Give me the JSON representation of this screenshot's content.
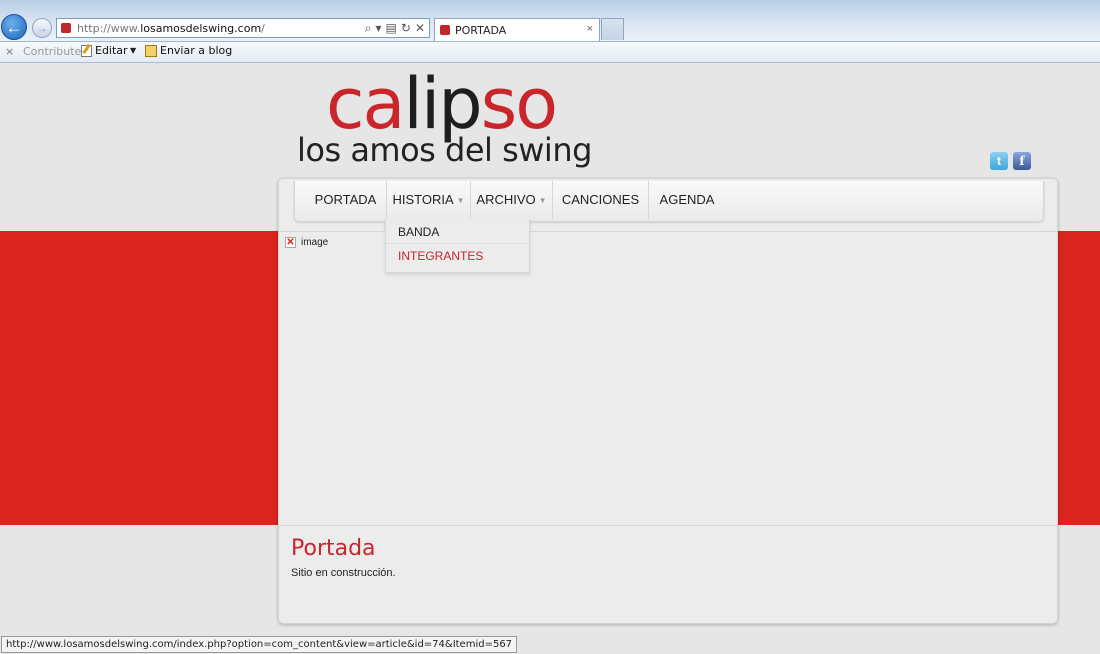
{
  "browser": {
    "address_prefix": "http://www.",
    "address_domain": "losamosdelswing.com",
    "address_suffix": "/",
    "tab_title": "PORTADA",
    "tab_close": "×",
    "back_glyph": "←",
    "forward_glyph": "→",
    "address_icons": [
      "⌕",
      "▾",
      "▤",
      "↻",
      "✕"
    ]
  },
  "command_bar": {
    "close": "×",
    "contribute": "Contribute",
    "edit": "Editar",
    "edit_dropdown": "▼",
    "send_to_blog": "Enviar a blog"
  },
  "logo": {
    "part1": "ca",
    "part2": "lip",
    "part3": "so",
    "subtitle": "los amos del swing"
  },
  "social": {
    "twitter_glyph": "t",
    "facebook_glyph": "f"
  },
  "nav": {
    "items": [
      {
        "label": "PORTADA",
        "has_submenu": false
      },
      {
        "label": "HISTORIA",
        "has_submenu": true
      },
      {
        "label": "ARCHIVO",
        "has_submenu": true
      },
      {
        "label": "CANCIONES",
        "has_submenu": false
      },
      {
        "label": "AGENDA",
        "has_submenu": false
      }
    ],
    "submenu_arrow": "▼"
  },
  "dropdown": {
    "items": [
      "BANDA",
      "INTEGRANTES"
    ]
  },
  "banner": {
    "broken_alt": "image",
    "broken_glyph": "✕"
  },
  "article": {
    "title": "Portada",
    "body": "Sitio en construcción."
  },
  "status_bar": {
    "url": "http://www.losamosdelswing.com/index.php?option=com_content&view=article&id=74&Itemid=567"
  },
  "colors": {
    "brand_red": "#c9252b",
    "band_red": "#d9251d",
    "page_bg": "#e6e6e6"
  }
}
